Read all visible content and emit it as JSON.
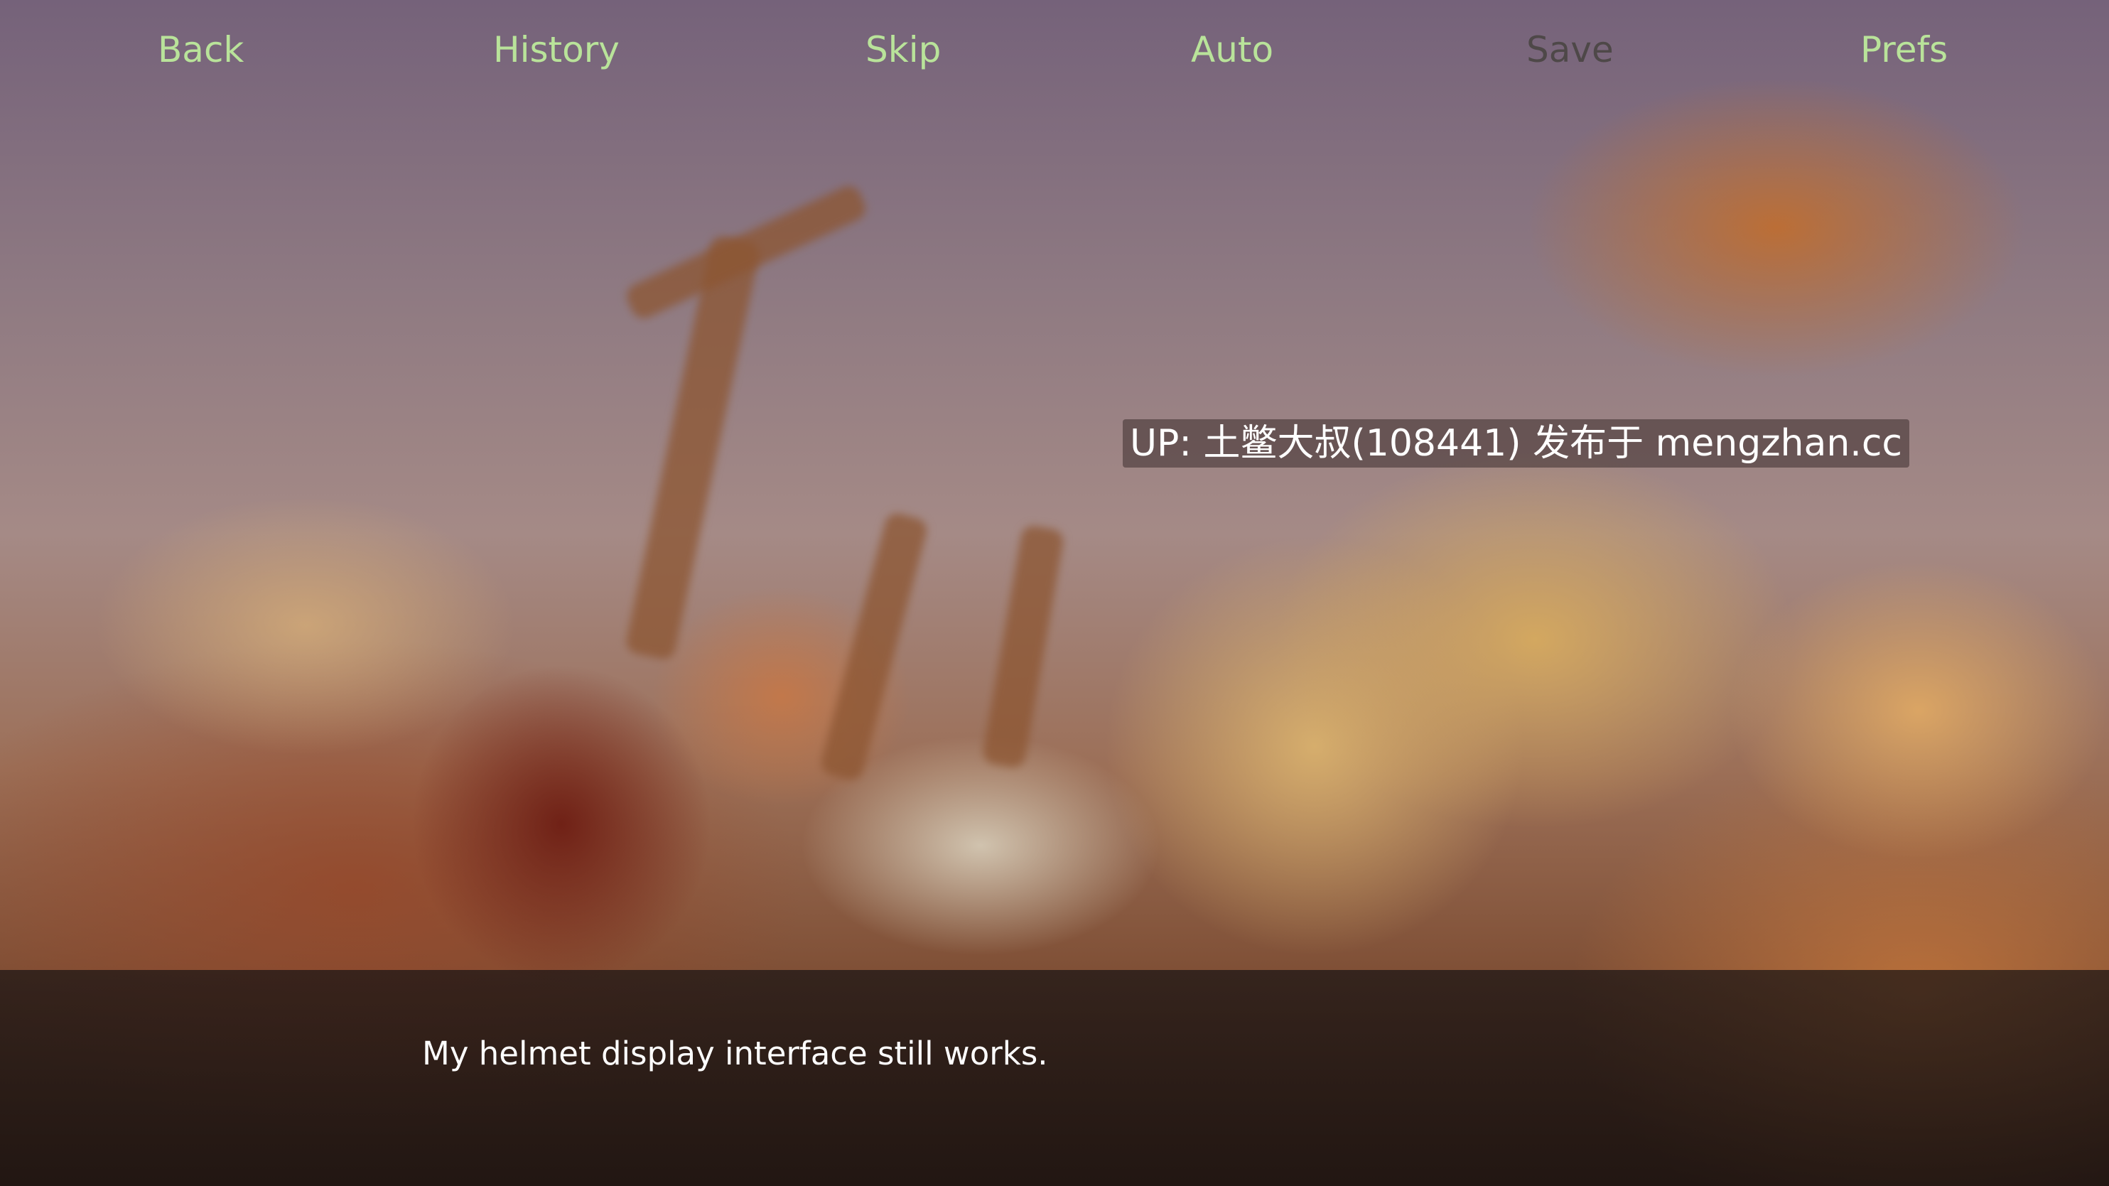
{
  "quick_menu": {
    "back": "Back",
    "history": "History",
    "skip": "Skip",
    "auto": "Auto",
    "save": "Save",
    "prefs": "Prefs"
  },
  "watermark": {
    "text": "UP: 土鳖大叔(108441) 发布于 mengzhan.cc"
  },
  "dialogue": {
    "text": "My helmet display interface still works."
  },
  "colors": {
    "menu_active": "#b9e39a",
    "menu_disabled": "#4e4848",
    "dialogue_text": "#ffffff"
  },
  "icons": {
    "scene": "blurred-desert-debris-background"
  }
}
